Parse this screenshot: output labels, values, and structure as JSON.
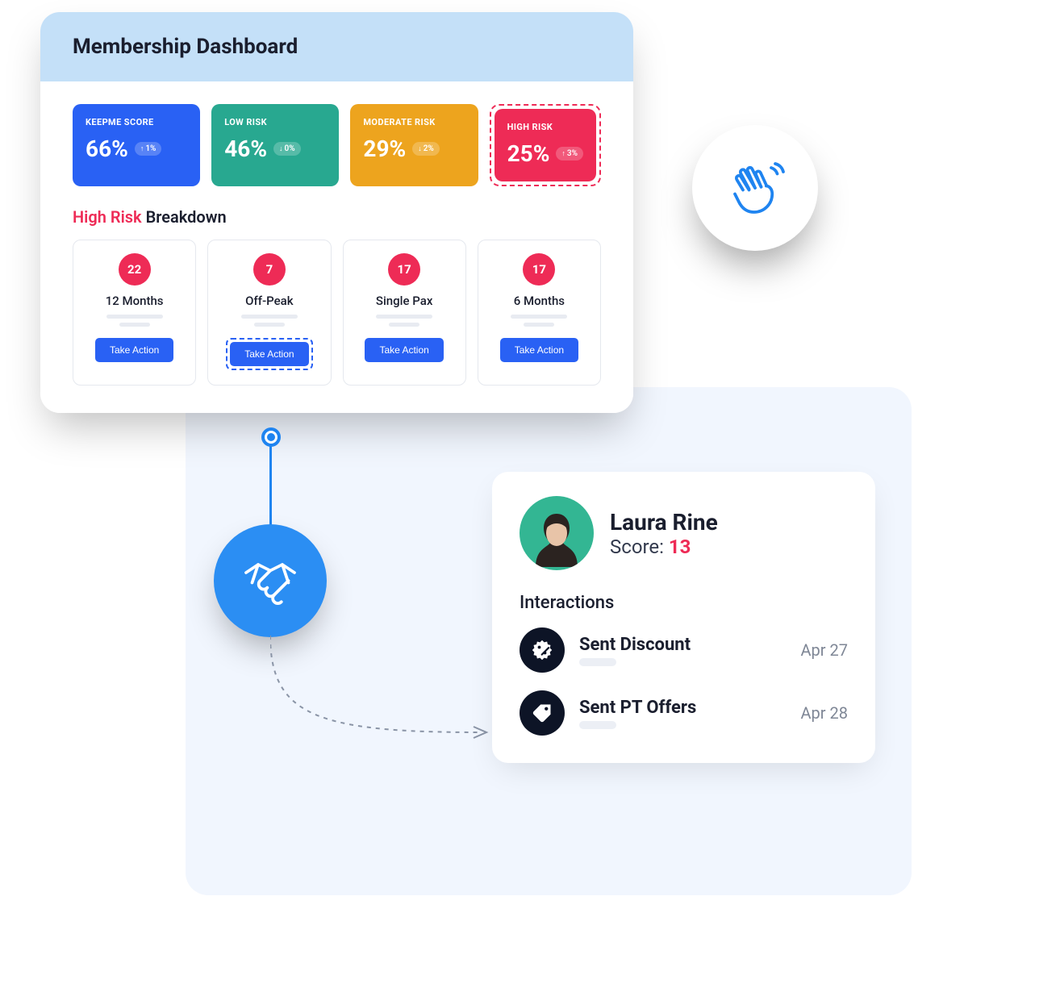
{
  "dashboard": {
    "title": "Membership Dashboard",
    "stats": [
      {
        "label": "KEEPME SCORE",
        "value": "66%",
        "delta": "1%",
        "dir": "up"
      },
      {
        "label": "LOW RISK",
        "value": "46%",
        "delta": "0%",
        "dir": "down"
      },
      {
        "label": "MODERATE RISK",
        "value": "29%",
        "delta": "2%",
        "dir": "down"
      },
      {
        "label": "HIGH RISK",
        "value": "25%",
        "delta": "3%",
        "dir": "up"
      }
    ],
    "breakdown_title_risk": "High Risk",
    "breakdown_title_rest": " Breakdown",
    "breakdowns": [
      {
        "count": "22",
        "label": "12 Months",
        "action": "Take Action"
      },
      {
        "count": "7",
        "label": "Off-Peak",
        "action": "Take Action"
      },
      {
        "count": "17",
        "label": "Single Pax",
        "action": "Take Action"
      },
      {
        "count": "17",
        "label": "6 Months",
        "action": "Take Action"
      }
    ]
  },
  "member": {
    "name": "Laura Rine",
    "score_label": "Score: ",
    "score_value": "13",
    "interactions_title": "Interactions",
    "interactions": [
      {
        "label": "Sent Discount",
        "date": "Apr 27",
        "icon": "discount"
      },
      {
        "label": "Sent PT Offers",
        "date": "Apr 28",
        "icon": "tag"
      }
    ]
  },
  "colors": {
    "blue": "#2961f4",
    "green": "#28a890",
    "orange": "#eda41e",
    "red": "#ee2b56",
    "accent": "#1f84f0"
  }
}
